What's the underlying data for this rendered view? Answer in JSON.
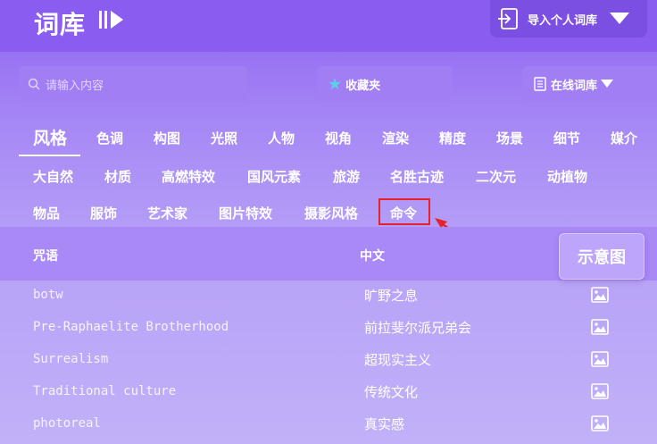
{
  "header": {
    "title": "词库",
    "import_label": "导入个人词库"
  },
  "toolbar": {
    "search_placeholder": "请输入内容",
    "favorites_label": "收藏夹",
    "online_label": "在线词库"
  },
  "tabs": [
    "风格",
    "色调",
    "构图",
    "光照",
    "人物",
    "视角",
    "渲染",
    "精度",
    "场景",
    "细节",
    "媒介"
  ],
  "categories": {
    "row1": [
      "大自然",
      "材质",
      "高燃特效",
      "国风元素",
      "旅游",
      "名胜古迹",
      "二次元",
      "动植物"
    ],
    "row2": [
      "物品",
      "服饰",
      "艺术家",
      "图片特效",
      "摄影风格",
      "命令"
    ]
  },
  "table": {
    "col_spell": "咒语",
    "col_chinese": "中文",
    "col_preview": "示意图",
    "rows": [
      {
        "en": "botw",
        "zh": "旷野之息"
      },
      {
        "en": "Pre-Raphaelite Brotherhood",
        "zh": "前拉斐尔派兄弟会"
      },
      {
        "en": "Surrealism",
        "zh": "超现实主义"
      },
      {
        "en": "Traditional culture",
        "zh": "传统文化"
      },
      {
        "en": "photoreal",
        "zh": "真实感"
      }
    ]
  },
  "colors": {
    "accent": "#8b5cf0",
    "highlight": "#e8202a",
    "star": "#5ad1e6"
  }
}
